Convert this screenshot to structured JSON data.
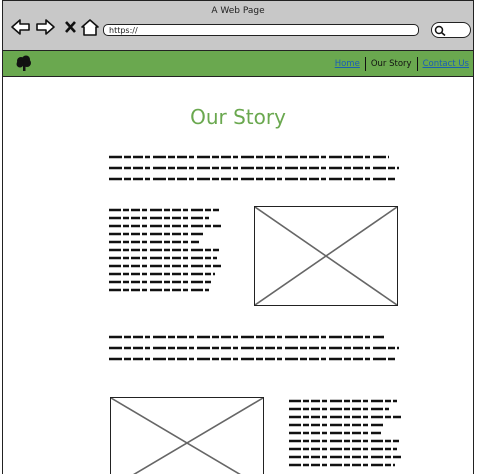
{
  "window": {
    "title": "A Web Page"
  },
  "toolbar": {
    "url": "https://"
  },
  "nav": {
    "home": "Home",
    "story": "Our Story",
    "contact": "Contact Us"
  },
  "main": {
    "heading": "Our Story"
  },
  "colors": {
    "accent": "#6aa84f",
    "link": "#1a5fb4",
    "chrome": "#c8c8c8"
  },
  "icons": [
    "back-arrow-icon",
    "forward-arrow-icon",
    "close-icon",
    "home-icon",
    "search-icon",
    "tree-logo-icon",
    "image-placeholder-icon"
  ]
}
